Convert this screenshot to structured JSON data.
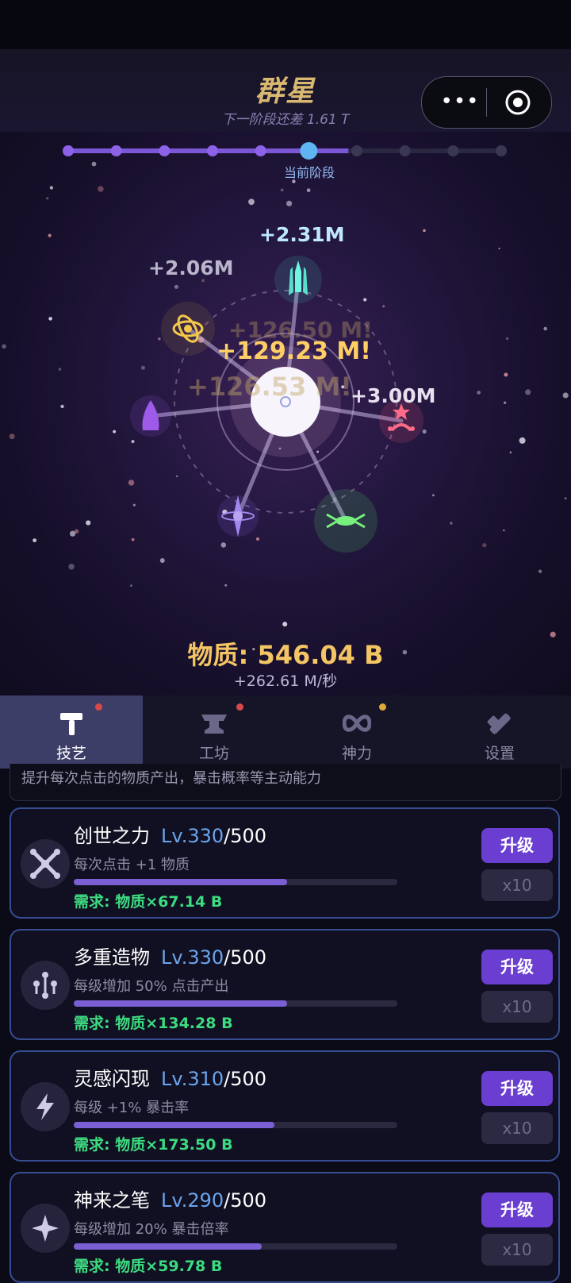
{
  "header": {
    "title": "群星",
    "subtitle": "下一阶段还差 1.61 T",
    "menu_dots": "•••"
  },
  "stage": {
    "label": "当前阶段",
    "current": 6,
    "total": 10
  },
  "floating_gains": {
    "top": "+2.31M",
    "left": "+2.06M",
    "ghost_1": "+126.50 M!",
    "crit": "+129.23 M!",
    "ghost_2": "+126.53 M!",
    "right": "+3.00M"
  },
  "matter": {
    "label": "物质: 546.04 B",
    "rate": "+262.61 M/秒"
  },
  "tabs": [
    {
      "label": "技艺",
      "icon": "hammer-icon",
      "active": true,
      "dot": "#d64a4a"
    },
    {
      "label": "工坊",
      "icon": "anvil-icon",
      "active": false,
      "dot": "#d64a4a"
    },
    {
      "label": "神力",
      "icon": "infinity-icon",
      "active": false,
      "dot": "#e0a93a"
    },
    {
      "label": "设置",
      "icon": "wrench-icon",
      "active": false,
      "dot": ""
    }
  ],
  "description": "提升每次点击的物质产出，暴击概率等主动能力",
  "skills": [
    {
      "name": "创世之力",
      "level": "Lv.330",
      "max": "/500",
      "note": "每次点击 +1 物质",
      "progress": 0.66,
      "requirement": "需求: 物质×67.14 B",
      "upgrade": "升级",
      "x10": "x10",
      "icon": "cross-burst-icon"
    },
    {
      "name": "多重造物",
      "level": "Lv.330",
      "max": "/500",
      "note": "每级增加 50% 点击产出",
      "progress": 0.66,
      "requirement": "需求: 物质×134.28 B",
      "upgrade": "升级",
      "x10": "x10",
      "icon": "multi-node-icon"
    },
    {
      "name": "灵感闪现",
      "level": "Lv.310",
      "max": "/500",
      "note": "每级 +1% 暴击率",
      "progress": 0.62,
      "requirement": "需求: 物质×173.50 B",
      "upgrade": "升级",
      "x10": "x10",
      "icon": "lightning-icon"
    },
    {
      "name": "神来之笔",
      "level": "Lv.290",
      "max": "/500",
      "note": "每级增加 20% 暴击倍率",
      "progress": 0.58,
      "requirement": "需求: 物质×59.78 B",
      "upgrade": "升级",
      "x10": "x10",
      "icon": "sparkle-icon"
    }
  ]
}
